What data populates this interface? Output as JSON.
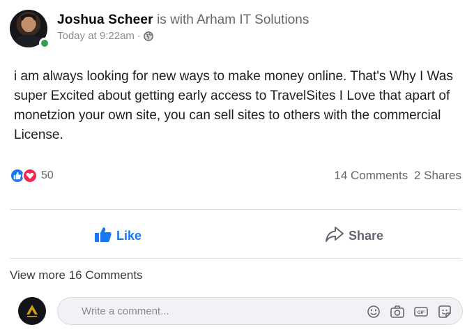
{
  "post": {
    "author": "Joshua Scheer",
    "with_text": "is with",
    "page_name": "Arham IT Solutions",
    "timestamp": "Today at 9:22am",
    "separator": "·",
    "privacy_icon": "globe-icon",
    "body": "i am always looking for new ways to make money online. That's Why I Was super Excited about getting early access to TravelSites I Love that apart of monetzion your own site, you can sell sites to others with the commercial License."
  },
  "stats": {
    "reaction_icons": [
      "like-icon",
      "love-icon"
    ],
    "reaction_count": "50",
    "comments": "14 Comments",
    "shares": "2 Shares"
  },
  "actions": {
    "like_label": "Like",
    "share_label": "Share"
  },
  "comments": {
    "view_more": "View more 16 Comments",
    "placeholder": "Write a comment...",
    "input_icons": [
      "emoji-icon",
      "camera-icon",
      "gif-icon",
      "sticker-icon"
    ]
  },
  "colors": {
    "online": "#31a24c",
    "like_blue": "#1877f2",
    "love_red": "#f02849",
    "meta_gray": "#65676b"
  }
}
